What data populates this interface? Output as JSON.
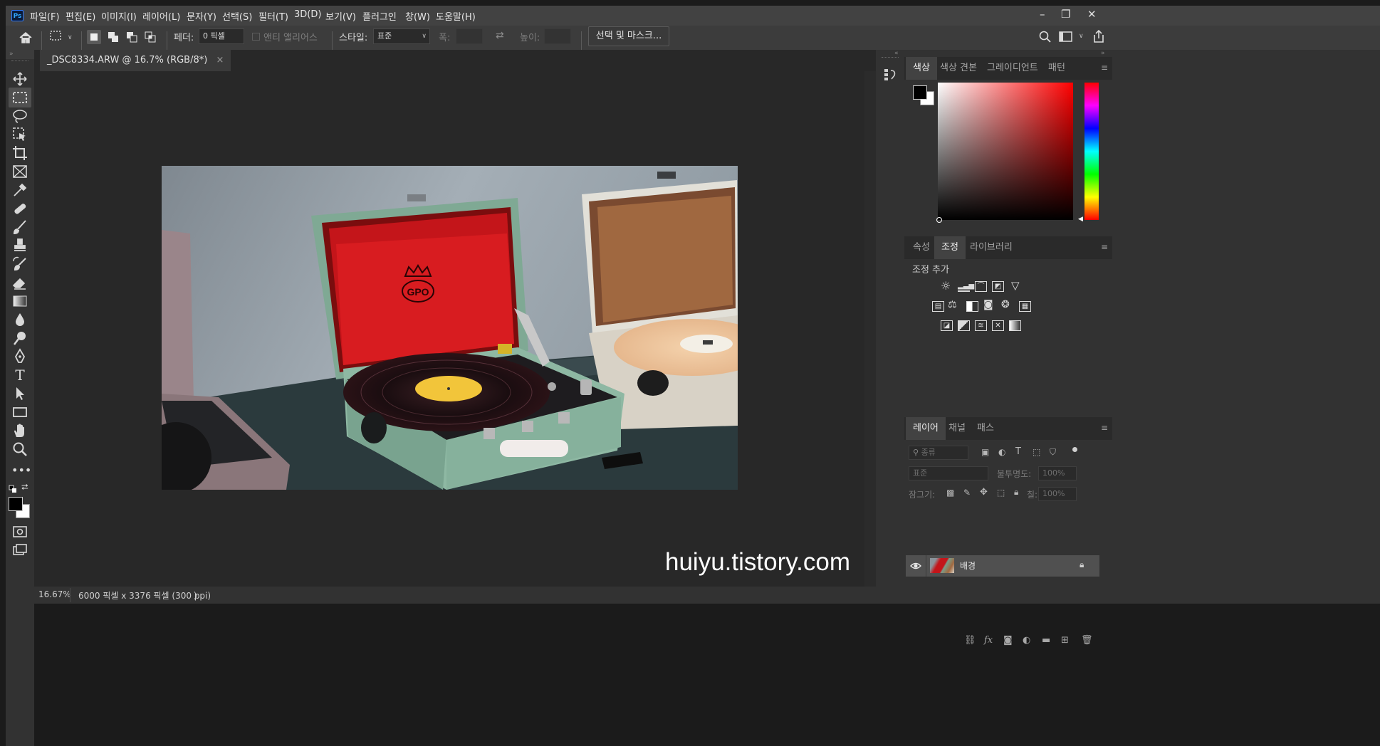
{
  "menubar": {
    "app_icon": "Ps",
    "items": [
      "파일(F)",
      "편집(E)",
      "이미지(I)",
      "레이어(L)",
      "문자(Y)",
      "선택(S)",
      "필터(T)",
      "3D(D)",
      "보기(V)",
      "플러그인",
      "창(W)",
      "도움말(H)"
    ],
    "window_controls": [
      "–",
      "❐",
      "✕"
    ]
  },
  "options": {
    "feather_label": "페더:",
    "feather_value": "0 픽셀",
    "antialias_label": "앤티 앨리어스",
    "style_label": "스타일:",
    "style_value": "표준",
    "width_label": "폭:",
    "height_label": "높이:",
    "select_mask_button": "선택 및 마스크..."
  },
  "document": {
    "tab_title": "_DSC8334.ARW @ 16.7% (RGB/8*)",
    "tab_close": "×",
    "zoom": "16.67%",
    "dimensions": "6000 픽셀 x 3376 픽셀 (300 ppi)",
    "status_arrow": "〉",
    "watermark": "huiyu.tistory.com",
    "photo_logo": "GPO"
  },
  "color_panel": {
    "tabs": [
      "색상",
      "색상 견본",
      "그레이디언트",
      "패턴"
    ],
    "active_tab": "색상",
    "hue_color": "#ff0000"
  },
  "adjust_panel": {
    "tabs": [
      "속성",
      "조정",
      "라이브러리"
    ],
    "active_tab": "조정",
    "heading": "조정 추가"
  },
  "layers_panel": {
    "tabs": [
      "레이어",
      "채널",
      "패스"
    ],
    "active_tab": "레이어",
    "filter_placeholder": "종류",
    "blend_mode": "표준",
    "opacity_label": "불투명도:",
    "opacity_value": "100%",
    "lock_label": "잠그기:",
    "fill_label": "칠:",
    "fill_value": "100%",
    "layers": [
      {
        "name": "배경",
        "visible": true,
        "locked": true
      }
    ]
  }
}
